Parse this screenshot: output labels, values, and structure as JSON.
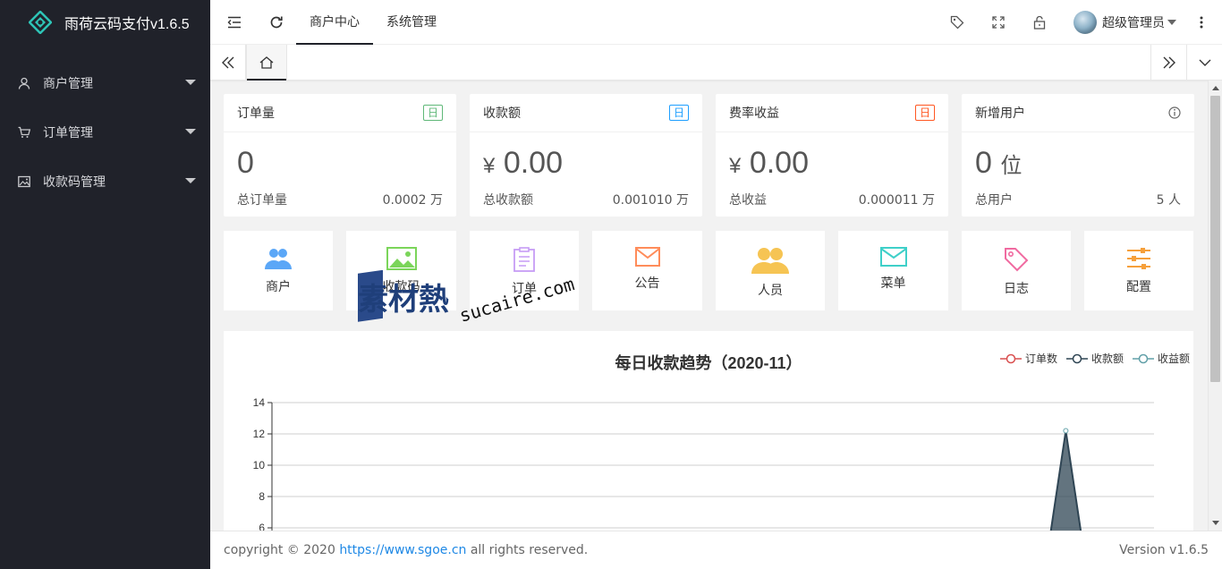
{
  "app": {
    "title": "雨荷云码支付v1.6.5"
  },
  "sidebar": {
    "items": [
      {
        "label": "商户管理",
        "icon": "user-icon"
      },
      {
        "label": "订单管理",
        "icon": "cart-icon"
      },
      {
        "label": "收款码管理",
        "icon": "image-icon"
      }
    ]
  },
  "header": {
    "tabs": [
      {
        "label": "商户中心",
        "active": true
      },
      {
        "label": "系统管理",
        "active": false
      }
    ],
    "user": {
      "name": "超级管理员"
    }
  },
  "stats": [
    {
      "title": "订单量",
      "badge": "日",
      "badge_color": "#5fb878",
      "value": "0",
      "unit": "",
      "foot_label": "总订单量",
      "foot_value": "0.0002 万"
    },
    {
      "title": "收款额",
      "badge": "日",
      "badge_color": "#1e9fff",
      "value": "0.00",
      "unit": "¥",
      "foot_label": "总收款额",
      "foot_value": "0.001010 万"
    },
    {
      "title": "费率收益",
      "badge": "日",
      "badge_color": "#ff5722",
      "value": "0.00",
      "unit": "¥",
      "foot_label": "总收益",
      "foot_value": "0.000011 万"
    },
    {
      "title": "新增用户",
      "badge": "",
      "badge_color": "",
      "value": "0",
      "unit": "位",
      "foot_label": "总用户",
      "foot_value": "5 人"
    }
  ],
  "quick_links": [
    {
      "label": "商户",
      "icon": "users-icon",
      "color": "#5ba7f7"
    },
    {
      "label": "收款码",
      "icon": "picture-icon",
      "color": "#7bd55a"
    },
    {
      "label": "订单",
      "icon": "clipboard-icon",
      "color": "#c69cf5"
    },
    {
      "label": "公告",
      "icon": "mail-icon",
      "color": "#ff8c5a"
    },
    {
      "label": "人员",
      "icon": "group-icon",
      "color": "#f6c453"
    },
    {
      "label": "菜单",
      "icon": "envelope-icon",
      "color": "#3fd0c9"
    },
    {
      "label": "日志",
      "icon": "tag-icon",
      "color": "#f06aa0"
    },
    {
      "label": "配置",
      "icon": "sliders-icon",
      "color": "#f6a03b"
    }
  ],
  "chart_data": {
    "type": "area",
    "title": "每日收款趋势（2020-11）",
    "legend": [
      "订单数",
      "收款额",
      "收益额"
    ],
    "legend_colors": [
      "#d94f4f",
      "#2f4554",
      "#61a0a8"
    ],
    "legend_position": "top-right",
    "y_ticks": [
      6,
      8,
      10,
      12,
      14
    ],
    "y_visible_range": [
      6,
      14
    ],
    "grid": true,
    "series": [
      {
        "name": "收款额",
        "color": "#2f4554",
        "peak_index_fraction": 0.9,
        "peak_value": 12.2
      }
    ]
  },
  "footer": {
    "copyright_prefix": "copyright © 2020 ",
    "link": "https://www.sgoe.cn",
    "copyright_suffix": " all rights reserved.",
    "version": "Version v1.6.5"
  },
  "watermark": {
    "cn": "素材熱",
    "en": "sucaire.com"
  }
}
